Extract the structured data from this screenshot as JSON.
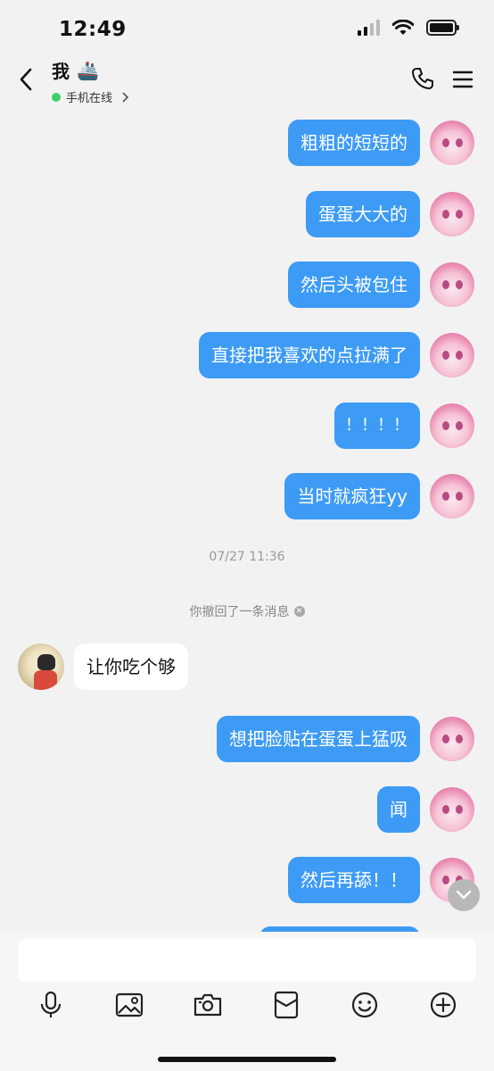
{
  "status_bar": {
    "time": "12:49"
  },
  "header": {
    "title": "我",
    "title_emoji": "🚢",
    "presence": "手机在线"
  },
  "messages": [
    {
      "side": "out",
      "text": "粗粗的短短的"
    },
    {
      "side": "out",
      "text": "蛋蛋大大的"
    },
    {
      "side": "out",
      "text": "然后头被包住"
    },
    {
      "side": "out",
      "text": "直接把我喜欢的点拉满了"
    },
    {
      "side": "out",
      "text": "！！！！"
    },
    {
      "side": "out",
      "text": "当时就疯狂yy"
    },
    {
      "type": "timestamp",
      "text": "07/27 11:36"
    },
    {
      "type": "recall",
      "text": "你撤回了一条消息"
    },
    {
      "side": "in",
      "text": "让你吃个够"
    },
    {
      "side": "out",
      "text": "想把脸贴在蛋蛋上猛吸"
    },
    {
      "side": "out",
      "text": "闻"
    },
    {
      "side": "out",
      "text": "然后再舔！！"
    }
  ],
  "input": {
    "value": ""
  },
  "toolbar": {
    "icons": [
      "mic-icon",
      "image-icon",
      "camera-icon",
      "red-packet-icon",
      "emoji-icon",
      "plus-icon"
    ]
  },
  "colors": {
    "bubble_out": "#3d9bf5",
    "bubble_in": "#ffffff",
    "background": "#f2f2f2",
    "online": "#3fcf6a"
  }
}
